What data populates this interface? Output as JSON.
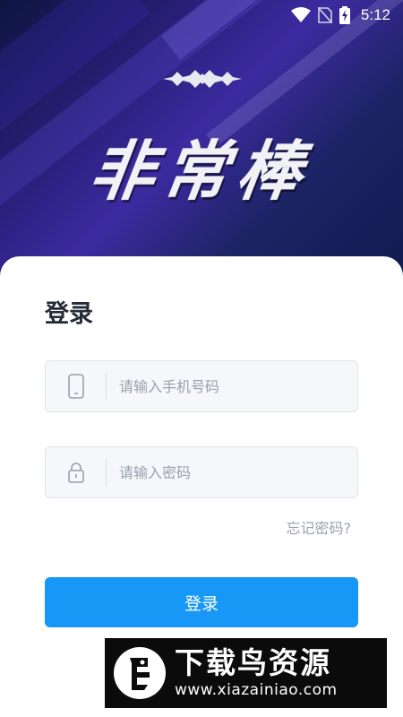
{
  "status_bar": {
    "time": "5:12",
    "icons": [
      "wifi-icon",
      "no-sim-icon",
      "battery-charging-icon"
    ]
  },
  "hero": {
    "title": "非常棒",
    "decoration_icon": "crown-ornament-icon"
  },
  "login": {
    "title": "登录",
    "phone_field": {
      "placeholder": "请输入手机号码",
      "value": "",
      "icon": "phone-icon"
    },
    "password_field": {
      "placeholder": "请输入密码",
      "value": "",
      "icon": "lock-icon"
    },
    "forgot_password": "忘记密码?",
    "submit_label": "登录"
  },
  "watermark": {
    "title": "下载鸟资源",
    "url": "www.xiazainiao.com"
  },
  "colors": {
    "accent": "#1797f6",
    "hero_dark": "#0d1540",
    "hero_purple": "#3d2aa0",
    "title_text": "#262b3a",
    "placeholder": "#9aa0ab"
  }
}
